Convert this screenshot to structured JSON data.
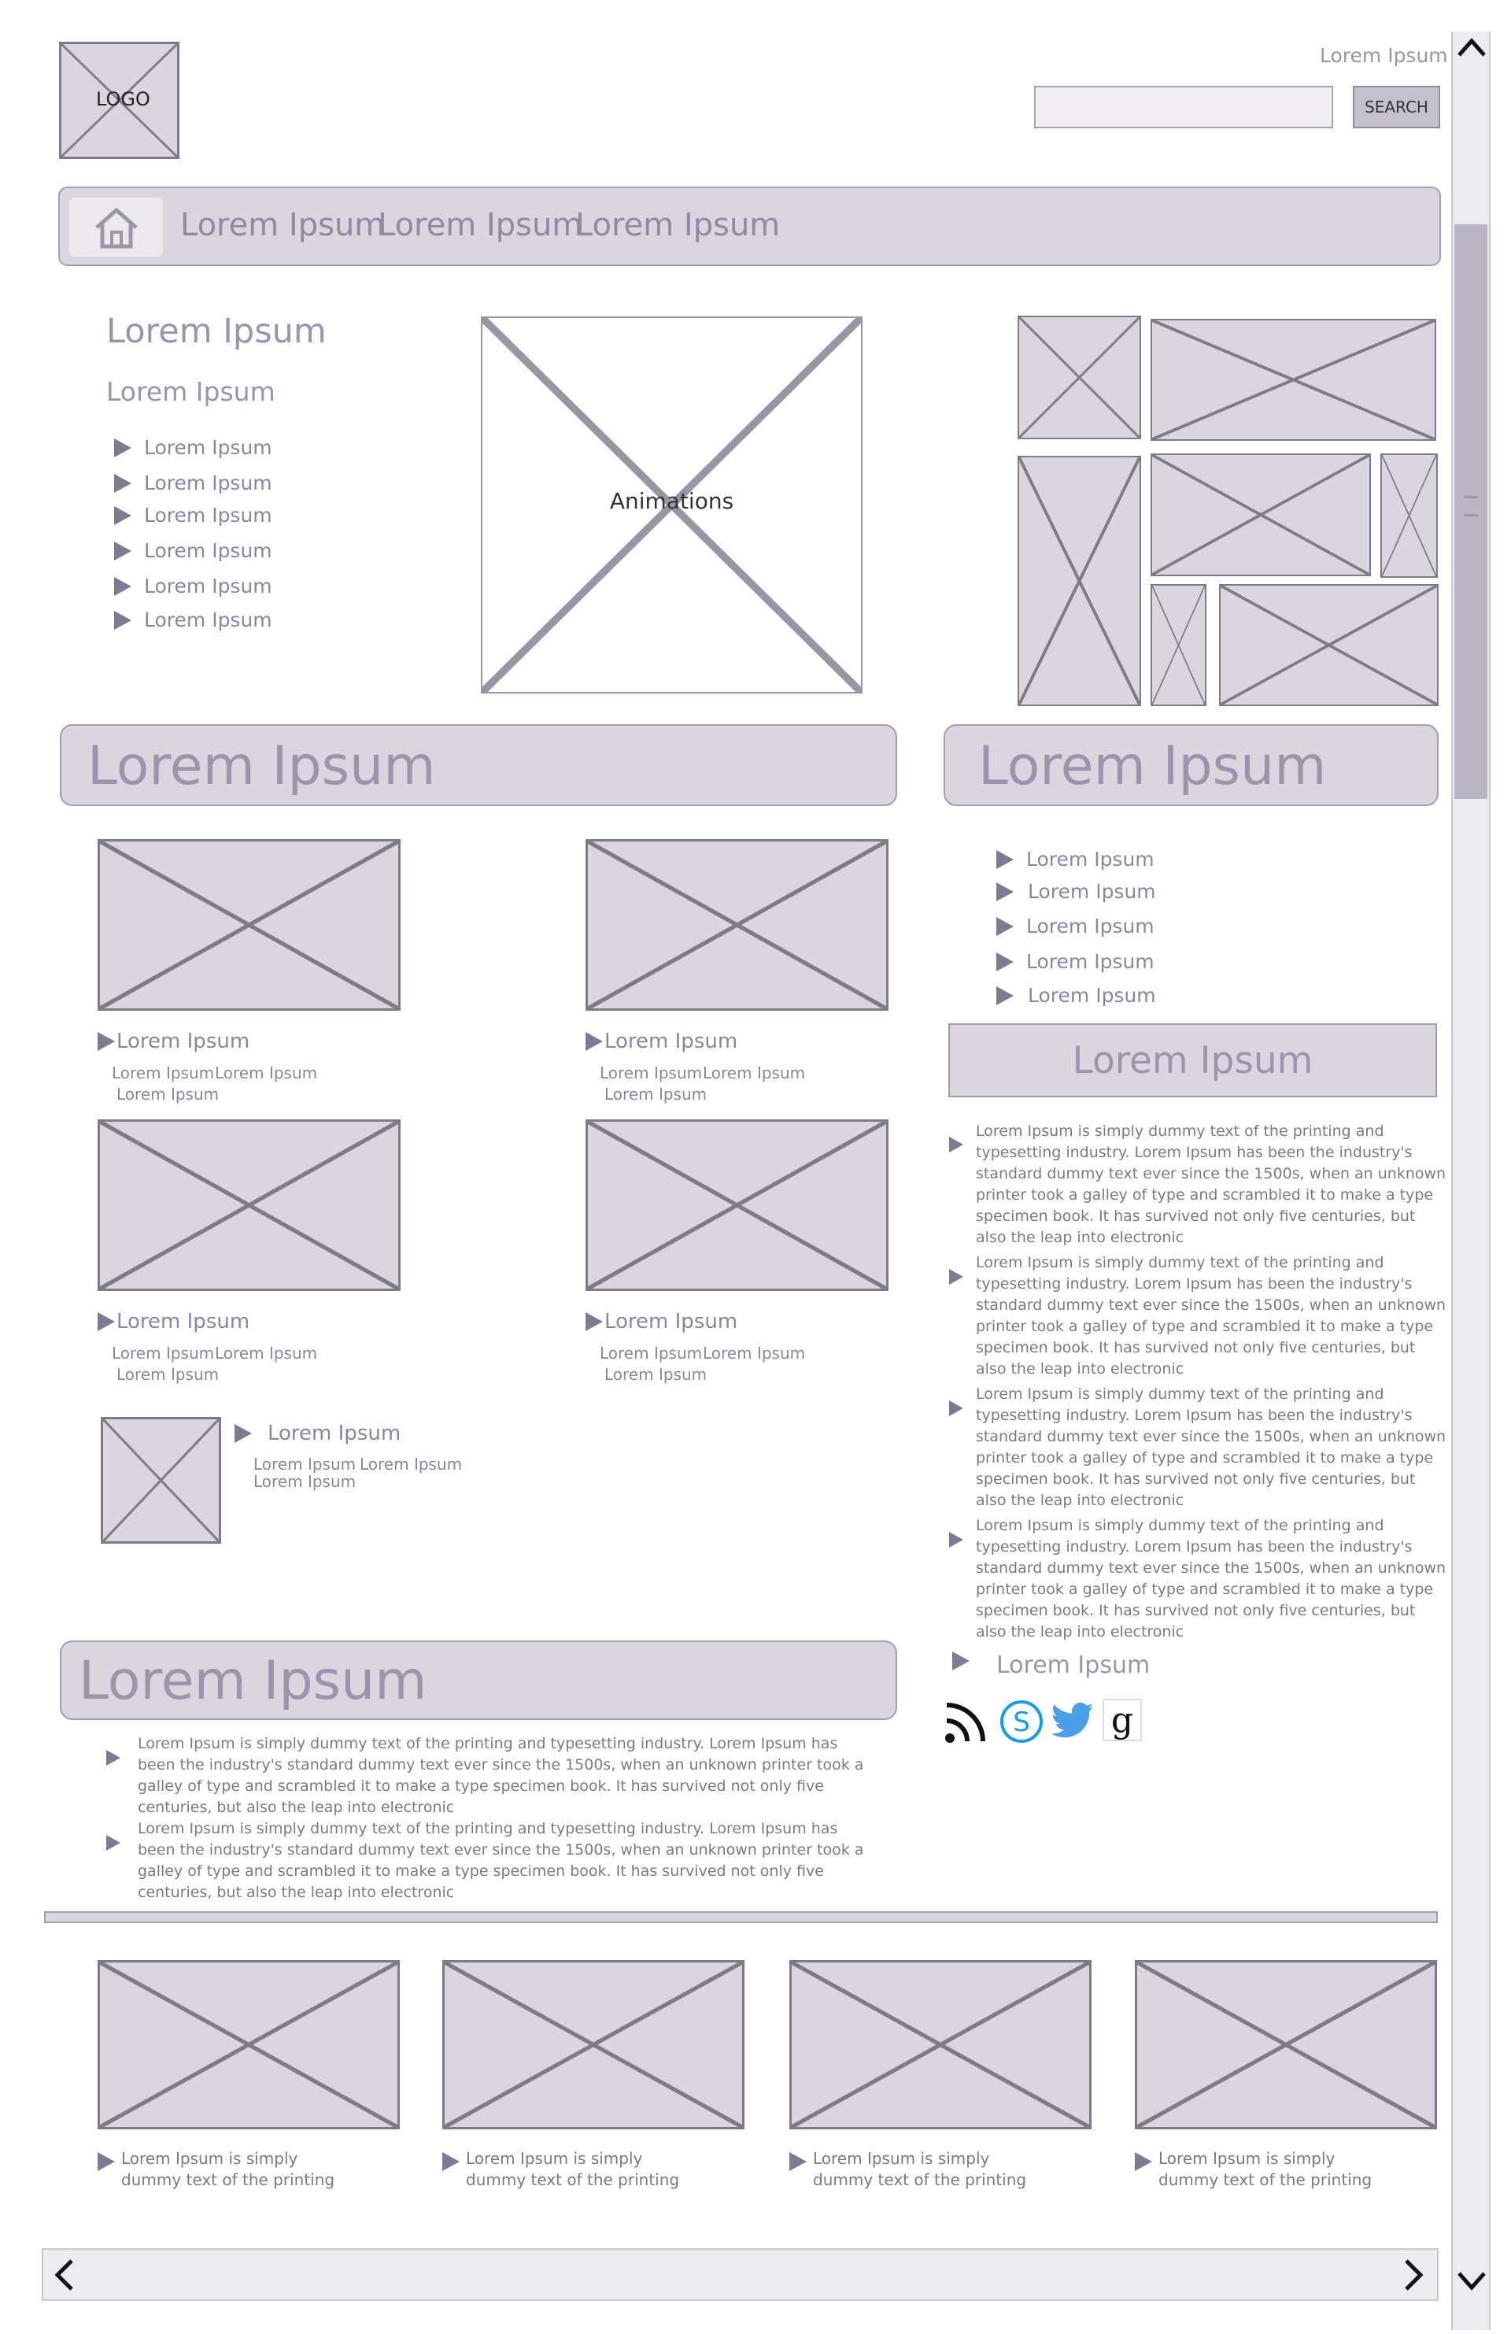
{
  "header": {
    "logo": "LOGO",
    "top_link": "Lorem Ipsum",
    "search_button": "SEARCH",
    "search_value": ""
  },
  "nav": {
    "items": [
      "Lorem Ipsum",
      "Lorem Ipsum",
      "Lorem Ipsum"
    ]
  },
  "hero": {
    "title": "Lorem Ipsum",
    "subtitle": "Lorem Ipsum",
    "list": [
      "Lorem Ipsum",
      "Lorem Ipsum",
      "Lorem Ipsum",
      "Lorem Ipsum",
      "Lorem Ipsum",
      "Lorem Ipsum"
    ],
    "animation_label": "Animations"
  },
  "main_heading": "Lorem Ipsum",
  "side_heading": "Lorem Ipsum",
  "cards": [
    {
      "title": "Lorem Ipsum",
      "tags": [
        "Lorem Ipsum",
        "Lorem Ipsum",
        "Lorem Ipsum"
      ]
    },
    {
      "title": "Lorem Ipsum",
      "tags": [
        "Lorem Ipsum",
        "Lorem Ipsum",
        "Lorem Ipsum"
      ]
    },
    {
      "title": "Lorem Ipsum",
      "tags": [
        "Lorem Ipsum",
        "Lorem Ipsum",
        "Lorem Ipsum"
      ]
    },
    {
      "title": "Lorem Ipsum",
      "tags": [
        "Lorem Ipsum",
        "Lorem Ipsum",
        "Lorem Ipsum"
      ]
    }
  ],
  "small_card": {
    "title": "Lorem Ipsum",
    "tags": [
      "Lorem Ipsum",
      "Lorem Ipsum",
      "Lorem Ipsum"
    ]
  },
  "side_list": [
    "Lorem Ipsum",
    "Lorem Ipsum",
    "Lorem Ipsum",
    "Lorem Ipsum",
    "Lorem Ipsum"
  ],
  "side_box_title": "Lorem Ipsum",
  "side_paragraphs": [
    "Lorem Ipsum is simply dummy text of the printing and typesetting industry. Lorem Ipsum has been the industry's standard dummy text ever since the 1500s, when an unknown printer took a galley of type and scrambled it to make a type specimen book. It has survived not only five centuries, but also the leap into electronic",
    "Lorem Ipsum is simply dummy text of the printing and typesetting industry. Lorem Ipsum has been the industry's standard dummy text ever since the 1500s, when an unknown printer took a galley of type and scrambled it to make a type specimen book. It has survived not only five centuries, but also the leap into electronic",
    "Lorem Ipsum is simply dummy text of the printing and typesetting industry. Lorem Ipsum has been the industry's standard dummy text ever since the 1500s, when an unknown printer took a galley of type and scrambled it to make a type specimen book. It has survived not only five centuries, but also the leap into electronic",
    "Lorem Ipsum is simply dummy text of the printing and typesetting industry. Lorem Ipsum has been the industry's standard dummy text ever since the 1500s, when an unknown printer took a galley of type and scrambled it to make a type specimen book. It has survived not only five centuries, but also the leap into electronic"
  ],
  "side_link": "Lorem Ipsum",
  "social_icons": [
    "rss-icon",
    "skype-icon",
    "twitter-icon",
    "google-icon"
  ],
  "bottom_heading": "Lorem Ipsum",
  "bottom_paragraphs": [
    "Lorem Ipsum is simply dummy text of the printing and typesetting industry. Lorem Ipsum has been the industry's standard dummy text ever since the 1500s, when an unknown printer took a galley of type and scrambled it to make a type specimen book. It has survived not only five centuries, but also the leap into electronic",
    "Lorem Ipsum is simply dummy text of the printing and typesetting industry. Lorem Ipsum has been the industry's standard dummy text ever since the 1500s, when an unknown printer took a galley of type and scrambled it to make a type specimen book. It has survived not only five centuries, but also the leap into electronic"
  ],
  "footer_cards": [
    "Lorem Ipsum is simply dummy text of the printing",
    "Lorem Ipsum is simply dummy text of the printing",
    "Lorem Ipsum is simply dummy text of the printing",
    "Lorem Ipsum is simply dummy text of the printing"
  ],
  "colors": {
    "placeholder_fill": "#dad5df",
    "border": "#7f7b86",
    "text": "#8a86a2",
    "twitter": "#4a9fe8",
    "skype": "#1e9be0"
  }
}
